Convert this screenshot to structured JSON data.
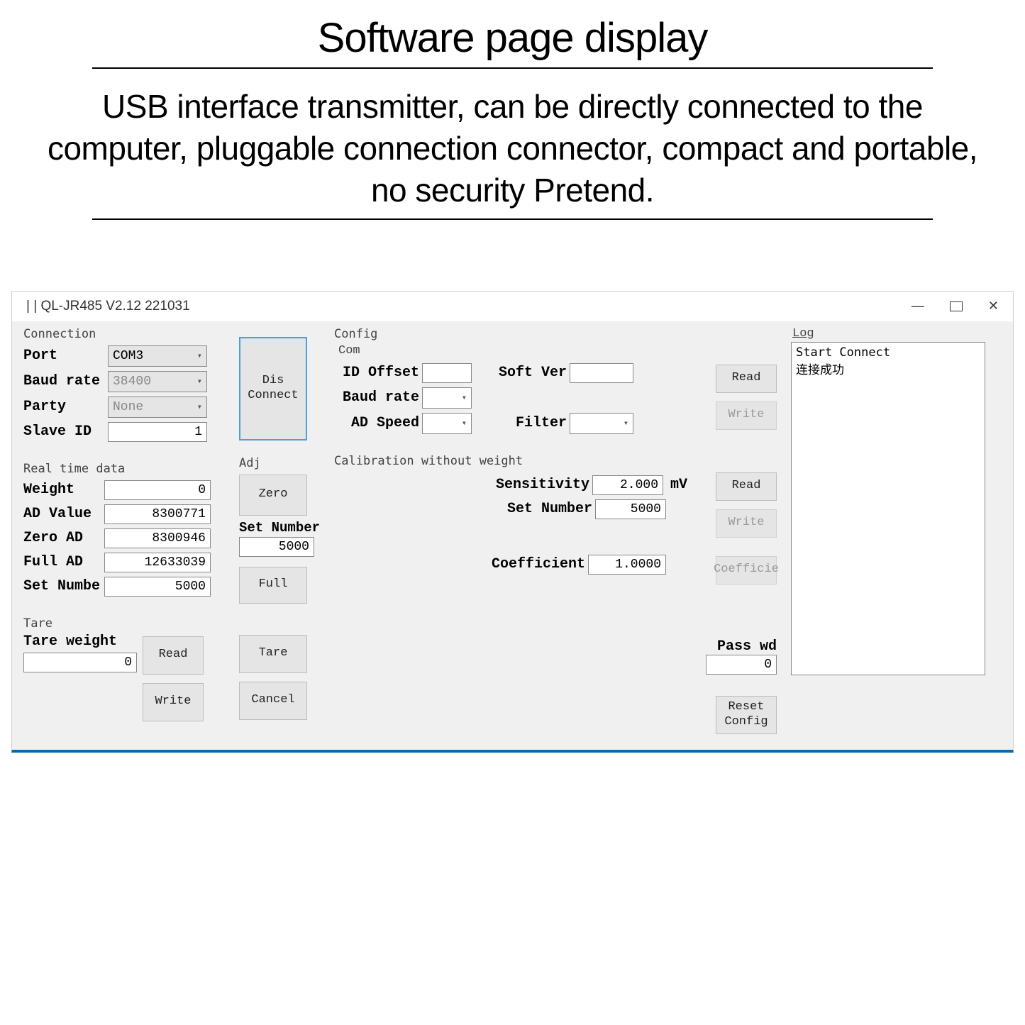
{
  "doc": {
    "title": "Software page display",
    "desc": "USB interface transmitter, can be directly connected to the computer, pluggable connection connector, compact and portable, no security Pretend."
  },
  "window": {
    "title": "QL-JR485 V2.12 221031"
  },
  "connection": {
    "group": "Connection",
    "port_label": "Port",
    "port_value": "COM3",
    "baud_label": "Baud rate",
    "baud_value": "38400",
    "party_label": "Party",
    "party_value": "None",
    "slave_label": "Slave ID",
    "slave_value": "1",
    "disconnect_btn": "Dis\nConnect"
  },
  "realtime": {
    "group": "Real time data",
    "weight_label": "Weight",
    "weight_value": "0",
    "ad_label": "AD Value",
    "ad_value": "8300771",
    "zero_ad_label": "Zero AD",
    "zero_ad_value": "8300946",
    "full_ad_label": "Full AD",
    "full_ad_value": "12633039",
    "setnum_label": "Set Numbe",
    "setnum_value": "5000"
  },
  "adj": {
    "group": "Adj",
    "zero_btn": "Zero",
    "setnum_label": "Set Number",
    "setnum_value": "5000",
    "full_btn": "Full"
  },
  "tare": {
    "group": "Tare",
    "tareweight_label": "Tare weight",
    "tareweight_value": "0",
    "read_btn": "Read",
    "tare_btn": "Tare",
    "write_btn": "Write",
    "cancel_btn": "Cancel"
  },
  "config": {
    "group": "Config",
    "com_sub": "Com",
    "idoff_label": "ID Offset",
    "idoff_value": "",
    "softver_label": "Soft Ver",
    "softver_value": "",
    "baud_label": "Baud rate",
    "baud_value": "",
    "adspeed_label": "AD Speed",
    "adspeed_value": "",
    "filter_label": "Filter",
    "filter_value": "",
    "read_btn": "Read",
    "write_btn": "Write"
  },
  "calib": {
    "group": "Calibration without weight",
    "sens_label": "Sensitivity",
    "sens_value": "2.000",
    "sens_unit": "mV",
    "setnum_label": "Set Number",
    "setnum_value": "5000",
    "coef_label": "Coefficient",
    "coef_value": "1.0000",
    "read_btn": "Read",
    "write_btn": "Write",
    "coeff_btn": "Coefficie"
  },
  "passwd": {
    "label": "Pass wd",
    "value": "0",
    "reset_btn": "Reset\nConfig"
  },
  "log": {
    "title": "Log",
    "lines": "Start Connect\n连接成功"
  }
}
